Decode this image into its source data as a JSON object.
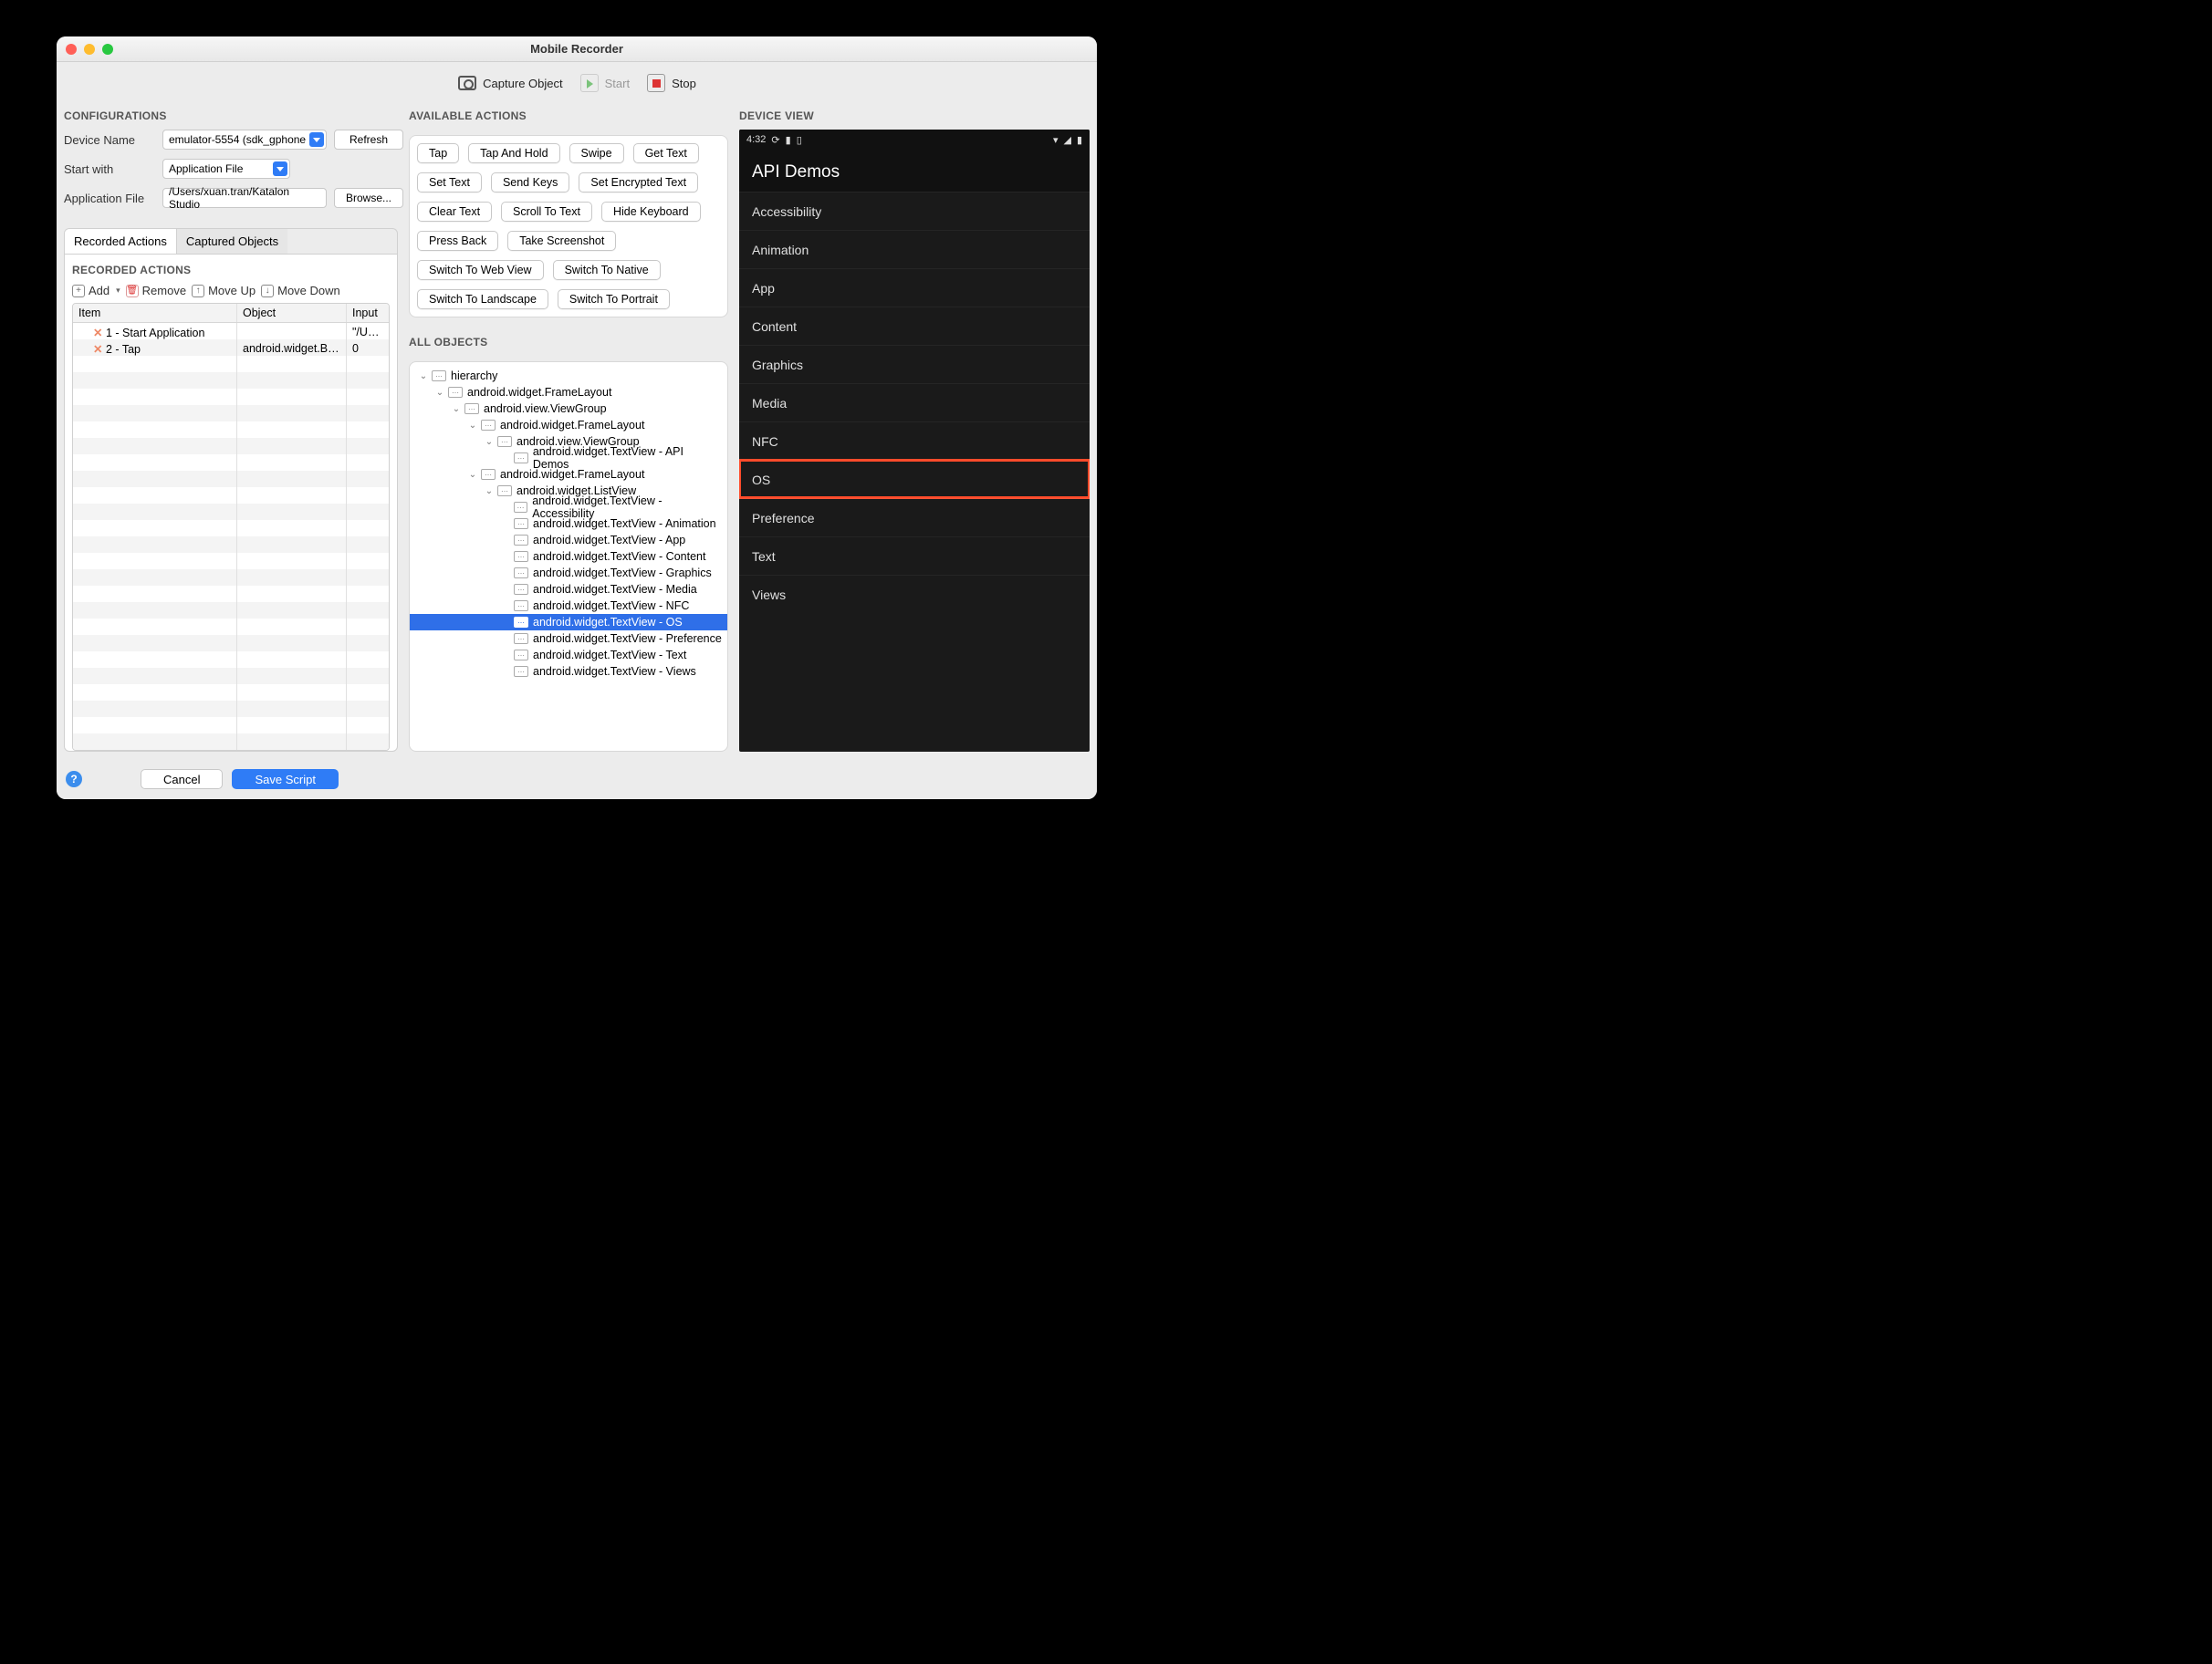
{
  "window": {
    "title": "Mobile Recorder"
  },
  "toolbar": {
    "capture": "Capture Object",
    "start": "Start",
    "stop": "Stop"
  },
  "configurations": {
    "heading": "CONFIGURATIONS",
    "device_label": "Device Name",
    "device_value": "emulator-5554 (sdk_gphone",
    "refresh": "Refresh",
    "start_with_label": "Start with",
    "start_with_value": "Application File",
    "app_file_label": "Application File",
    "app_file_value": "/Users/xuan.tran/Katalon Studio",
    "browse": "Browse..."
  },
  "tabs": {
    "recorded": "Recorded Actions",
    "captured": "Captured Objects"
  },
  "recorded": {
    "heading": "RECORDED ACTIONS",
    "add": "Add",
    "remove": "Remove",
    "move_up": "Move Up",
    "move_down": "Move Down",
    "cols": {
      "item": "Item",
      "object": "Object",
      "input": "Input"
    },
    "rows": [
      {
        "item": "1 - Start Application",
        "object": "",
        "input": "\"/Users/xu"
      },
      {
        "item": "2 - Tap",
        "object": "android.widget.Button",
        "input": "0"
      }
    ]
  },
  "actions": {
    "heading": "AVAILABLE ACTIONS",
    "list": [
      "Tap",
      "Tap And Hold",
      "Swipe",
      "Get Text",
      "Set Text",
      "Send Keys",
      "Set Encrypted Text",
      "Clear Text",
      "Scroll To Text",
      "Hide Keyboard",
      "Press Back",
      "Take Screenshot",
      "Switch To Web View",
      "Switch To Native",
      "Switch To Landscape",
      "Switch To Portrait"
    ]
  },
  "objects": {
    "heading": "ALL OBJECTS",
    "tree": [
      {
        "depth": 0,
        "exp": "open",
        "label": "hierarchy"
      },
      {
        "depth": 1,
        "exp": "open",
        "label": "android.widget.FrameLayout"
      },
      {
        "depth": 2,
        "exp": "open",
        "label": "android.view.ViewGroup"
      },
      {
        "depth": 3,
        "exp": "open",
        "label": "android.widget.FrameLayout"
      },
      {
        "depth": 4,
        "exp": "open",
        "label": "android.view.ViewGroup"
      },
      {
        "depth": 5,
        "exp": "leaf",
        "label": "android.widget.TextView - API Demos"
      },
      {
        "depth": 3,
        "exp": "open",
        "label": "android.widget.FrameLayout"
      },
      {
        "depth": 4,
        "exp": "open",
        "label": "android.widget.ListView"
      },
      {
        "depth": 5,
        "exp": "leaf",
        "label": "android.widget.TextView - Accessibility"
      },
      {
        "depth": 5,
        "exp": "leaf",
        "label": "android.widget.TextView - Animation"
      },
      {
        "depth": 5,
        "exp": "leaf",
        "label": "android.widget.TextView - App"
      },
      {
        "depth": 5,
        "exp": "leaf",
        "label": "android.widget.TextView - Content"
      },
      {
        "depth": 5,
        "exp": "leaf",
        "label": "android.widget.TextView - Graphics"
      },
      {
        "depth": 5,
        "exp": "leaf",
        "label": "android.widget.TextView - Media"
      },
      {
        "depth": 5,
        "exp": "leaf",
        "label": "android.widget.TextView - NFC"
      },
      {
        "depth": 5,
        "exp": "leaf",
        "label": "android.widget.TextView - OS",
        "selected": true
      },
      {
        "depth": 5,
        "exp": "leaf",
        "label": "android.widget.TextView - Preference"
      },
      {
        "depth": 5,
        "exp": "leaf",
        "label": "android.widget.TextView - Text"
      },
      {
        "depth": 5,
        "exp": "leaf",
        "label": "android.widget.TextView - Views"
      }
    ]
  },
  "device": {
    "heading": "DEVICE VIEW",
    "time": "4:32",
    "app_title": "API Demos",
    "items": [
      "Accessibility",
      "Animation",
      "App",
      "Content",
      "Graphics",
      "Media",
      "NFC",
      "OS",
      "Preference",
      "Text",
      "Views"
    ],
    "highlight_index": 7
  },
  "footer": {
    "cancel": "Cancel",
    "save": "Save Script"
  }
}
